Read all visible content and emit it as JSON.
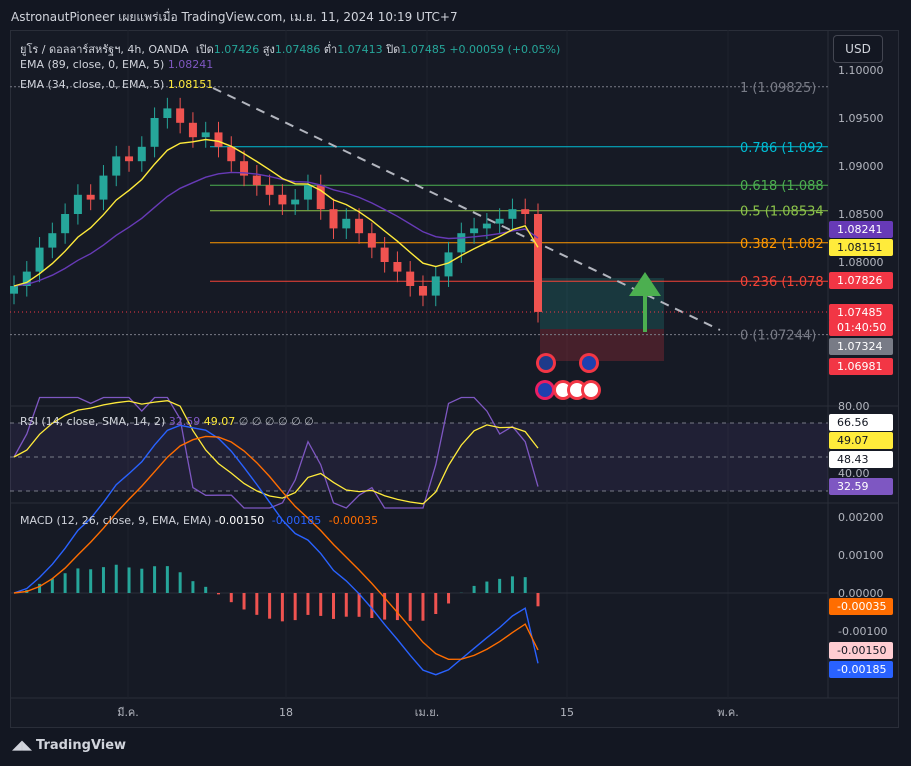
{
  "header": {
    "text": "AstronautPioneer เผยแพร่เมื่อ TradingView.com, เม.ย. 11, 2024 10:19 UTC+7"
  },
  "currency_button": "USD",
  "legend": {
    "symbol": "ยูโร / ดอลลาร์สหรัฐฯ, 4h, OANDA",
    "open_label": "เปิด",
    "open": "1.07426",
    "high_label": "สูง",
    "high": "1.07486",
    "low_label": "ต่ำ",
    "low": "1.07413",
    "close_label": "ปิด",
    "close": "1.07485",
    "change": "+0.00059 (+0.05%)",
    "ema89": "EMA (89, close, 0, EMA, 5)",
    "ema89_val": "1.08241",
    "ema34": "EMA (34, close, 0, EMA, 5)",
    "ema34_val": "1.08151",
    "rsi": "RSI (14, close, SMA, 14, 2)",
    "rsi_val1": "32.59",
    "rsi_val2": "49.07",
    "rsi_empty": "∅ ∅ ∅ ∅ ∅ ∅",
    "macd": "MACD (12, 26, close, 9, EMA, EMA)",
    "macd_v1": "-0.00150",
    "macd_v2": "-0.00185",
    "macd_v3": "-0.00035"
  },
  "fib": [
    {
      "label": "1 (1.09825)",
      "color": "#787b86"
    },
    {
      "label": "0.786 (1.092",
      "color": "#00bcd4"
    },
    {
      "label": "0.618 (1.088",
      "color": "#4caf50"
    },
    {
      "label": "0.5 (1.08534",
      "color": "#8bc34a"
    },
    {
      "label": "0.382 (1.082",
      "color": "#ff9800"
    },
    {
      "label": "0.236 (1.078",
      "color": "#f44336"
    },
    {
      "label": "0 (1.07244)",
      "color": "#787b86"
    }
  ],
  "price_axis": [
    "1.10000",
    "1.09500",
    "1.09000",
    "1.08500",
    "1.08000"
  ],
  "price_tags": [
    {
      "text": "1.08241",
      "bg": "#673ab7",
      "fg": "#ffffff"
    },
    {
      "text": "1.08151",
      "bg": "#ffeb3b",
      "fg": "#131722"
    },
    {
      "text": "1.07826",
      "bg": "#f23645",
      "fg": "#ffffff"
    },
    {
      "text": "1.07485",
      "bg": "#f23645",
      "fg": "#ffffff"
    },
    {
      "text": "01:40:50",
      "bg": "#f23645",
      "fg": "#ffffff"
    },
    {
      "text": "1.07324",
      "bg": "#787b86",
      "fg": "#ffffff"
    },
    {
      "text": "1.06981",
      "bg": "#f23645",
      "fg": "#ffffff"
    }
  ],
  "rsi_axis": [
    "80.00",
    "40.00"
  ],
  "rsi_tags": [
    {
      "text": "66.56",
      "bg": "#ffffff",
      "fg": "#131722"
    },
    {
      "text": "49.07",
      "bg": "#ffeb3b",
      "fg": "#131722"
    },
    {
      "text": "48.43",
      "bg": "#ffffff",
      "fg": "#131722"
    },
    {
      "text": "32.59",
      "bg": "#7e57c2",
      "fg": "#ffffff"
    }
  ],
  "macd_axis": [
    "0.00200",
    "0.00100",
    "0.00000",
    "-0.00100"
  ],
  "macd_tags": [
    {
      "text": "-0.00035",
      "bg": "#ff6d00",
      "fg": "#ffffff"
    },
    {
      "text": "-0.00150",
      "bg": "#ffcdd2",
      "fg": "#131722"
    },
    {
      "text": "-0.00185",
      "bg": "#2962ff",
      "fg": "#ffffff"
    }
  ],
  "time_axis": [
    "มี.ค.",
    "18",
    "เม.ย.",
    "15",
    "พ.ค."
  ],
  "footer": "TradingView",
  "chart_data": {
    "type": "line",
    "title": "ยูโร / ดอลลาร์สหรัฐฯ, 4h, OANDA",
    "price_close_approx": [
      1.0775,
      1.079,
      1.0815,
      1.083,
      1.085,
      1.087,
      1.0865,
      1.089,
      1.091,
      1.0905,
      1.092,
      1.095,
      1.096,
      1.0945,
      1.093,
      1.0935,
      1.092,
      1.0905,
      1.089,
      1.088,
      1.087,
      1.086,
      1.0865,
      1.088,
      1.0855,
      1.0835,
      1.0845,
      1.083,
      1.0815,
      1.08,
      1.079,
      1.0775,
      1.0765,
      1.0785,
      1.081,
      1.083,
      1.0835,
      1.084,
      1.0845,
      1.0855,
      1.085,
      1.0748
    ],
    "ema34": 1.08151,
    "ema89": 1.08241,
    "fib_levels": [
      1.09825,
      1.092,
      1.088,
      1.08534,
      1.082,
      1.078,
      1.07244
    ],
    "position": {
      "entry": 1.07324,
      "target": 1.07826,
      "stop": 1.06981
    },
    "rsi": {
      "value": 32.59,
      "ma": 49.07,
      "bands": [
        66.56,
        48.43
      ]
    },
    "macd": {
      "macd": -0.00185,
      "signal": -0.0015,
      "hist": -0.00035
    },
    "ylim": [
      1.069,
      1.1005
    ]
  }
}
